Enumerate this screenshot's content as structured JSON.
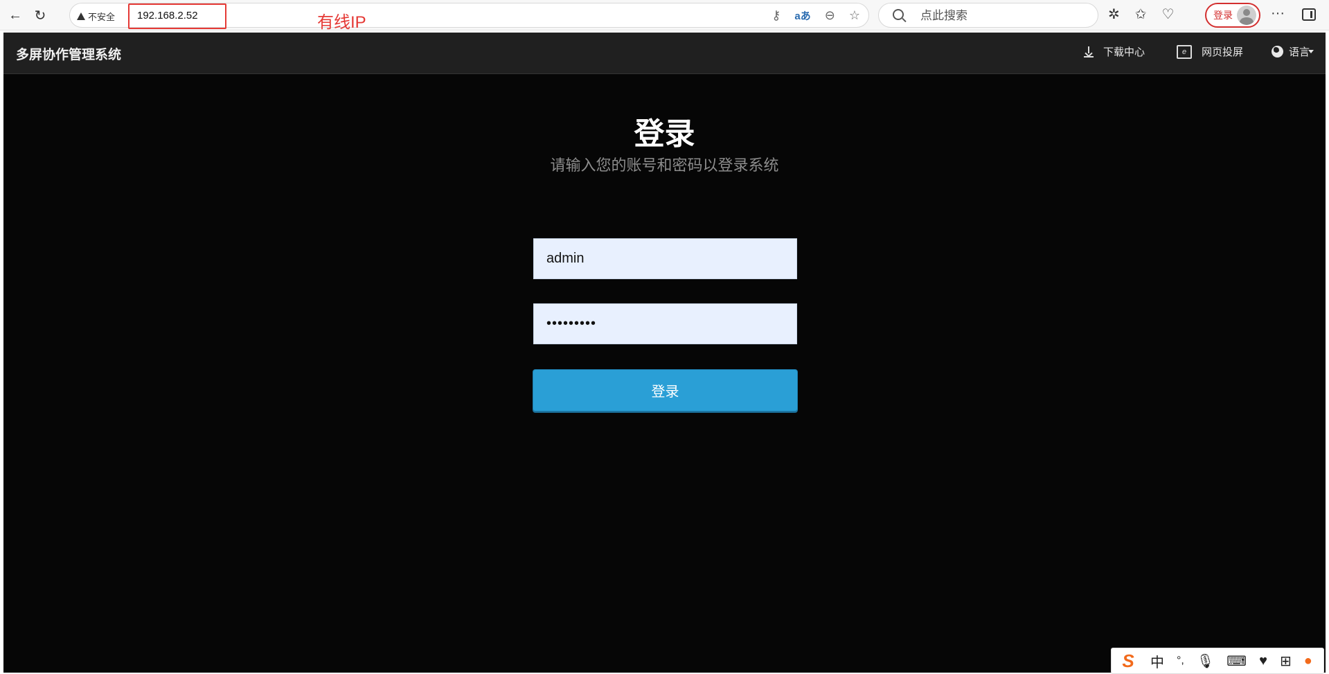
{
  "browser": {
    "insecure_label": "不安全",
    "url": "192.168.2.52",
    "annotation": "有线IP",
    "search_placeholder": "点此搜索",
    "account_label": "登录",
    "translate_label": "aあ",
    "more_label": "···"
  },
  "app": {
    "title": "多屏协作管理系统",
    "header": {
      "download_label": "下载中心",
      "cast_label": "网页投屏",
      "cast_icon_glyph": "e",
      "language_label": "语言"
    },
    "login": {
      "title": "登录",
      "subtitle": "请输入您的账号和密码以登录系统",
      "username_value": "admin",
      "password_value": "•••••••••",
      "button_label": "登录"
    }
  },
  "ime": {
    "logo": "S",
    "mode": "中",
    "punct": "°,"
  }
}
